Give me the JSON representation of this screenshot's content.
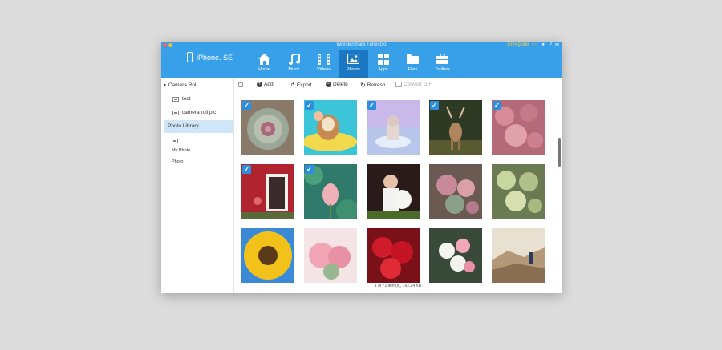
{
  "window": {
    "title": "Wondershare TunesGo",
    "register_label": "Unregister"
  },
  "device": {
    "name": "iPhone. SE"
  },
  "nav": [
    {
      "label": "Home",
      "icon": "home-icon"
    },
    {
      "label": "Music",
      "icon": "music-icon"
    },
    {
      "label": "Videos",
      "icon": "videos-icon"
    },
    {
      "label": "Photos",
      "icon": "photos-icon",
      "active": true
    },
    {
      "label": "Apps",
      "icon": "apps-icon"
    },
    {
      "label": "Files",
      "icon": "files-icon"
    },
    {
      "label": "Toolbox",
      "icon": "toolbox-icon"
    }
  ],
  "sidebar": {
    "heading": "Camera Roll",
    "items": [
      {
        "label": "test"
      },
      {
        "label": "camera roll pic"
      },
      {
        "label": "Photo Library",
        "selected": true
      },
      {
        "label": ""
      },
      {
        "label": "My Photo"
      },
      {
        "label": "Photo"
      }
    ]
  },
  "toolbar": {
    "add_label": "Add",
    "export_label": "Export",
    "delete_label": "Delete",
    "refresh_label": "Refresh",
    "convert_gif_label": "Convert GIF"
  },
  "photos": [
    {
      "subject": "succulent",
      "checked": true
    },
    {
      "subject": "dog-on-pool-float",
      "checked": true
    },
    {
      "subject": "figurine-pastel",
      "checked": true
    },
    {
      "subject": "deer",
      "checked": true
    },
    {
      "subject": "pink-succulents",
      "checked": true
    },
    {
      "subject": "red-barn-door",
      "checked": true
    },
    {
      "subject": "lotus-bud",
      "checked": true
    },
    {
      "subject": "girl-with-flowers",
      "checked": false
    },
    {
      "subject": "succulent-cluster",
      "checked": false
    },
    {
      "subject": "succulent-green",
      "checked": false
    },
    {
      "subject": "sunflower",
      "checked": false
    },
    {
      "subject": "pink-roses",
      "checked": false
    },
    {
      "subject": "red-roses",
      "checked": false
    },
    {
      "subject": "white-pink-bouquet",
      "checked": false
    },
    {
      "subject": "hiker-mountains",
      "checked": false
    }
  ],
  "status": {
    "text": "1 of 71 item(s), 792.24 KB"
  },
  "colors": {
    "header": "#37a0e8",
    "active_tab": "#1a78c2",
    "selection": "#cfe6f8",
    "checkbox": "#2e8fe0"
  }
}
